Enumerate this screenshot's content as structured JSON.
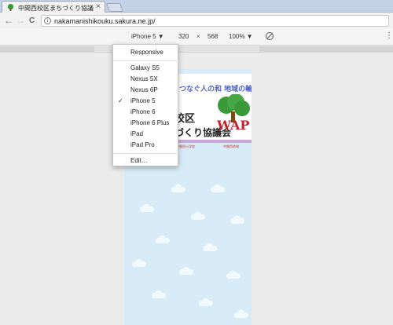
{
  "tab": {
    "title": "中間西校区まちづくり協議会",
    "close_glyph": "×",
    "favicon": "tree-icon"
  },
  "nav": {
    "back_glyph": "←",
    "forward_glyph": "→",
    "reload_glyph": "C",
    "info_glyph": "i",
    "url": "nakamanishikouku.sakura.ne.jp/"
  },
  "device_toolbar": {
    "device": "iPhone 5 ▼",
    "width": "320",
    "x": "×",
    "height": "568",
    "zoom": "100% ▼",
    "more_glyph": "⋮"
  },
  "menu": {
    "responsive": "Responsive",
    "devices": [
      "Galaxy S5",
      "Nexus 5X",
      "Nexus 6P",
      "iPhone 5",
      "iPhone 6",
      "iPhone 6 Plus",
      "iPad",
      "iPad Pro"
    ],
    "selected": "iPhone 5",
    "check_glyph": "✓",
    "edit": "Edit…"
  },
  "page": {
    "tagline": "つなぐ人の和 地域の輪",
    "title_line1": "校区",
    "title_line2": "づくり協議会",
    "logo_text": "WAP",
    "link_left": "中間西小学校",
    "link_right": "中間西地域"
  },
  "colors": {
    "tab_strip": "#c4d2e8",
    "page_bg": "#d8ecf8",
    "accent_red": "#c0202a",
    "tagline_blue": "#4f63c8"
  }
}
